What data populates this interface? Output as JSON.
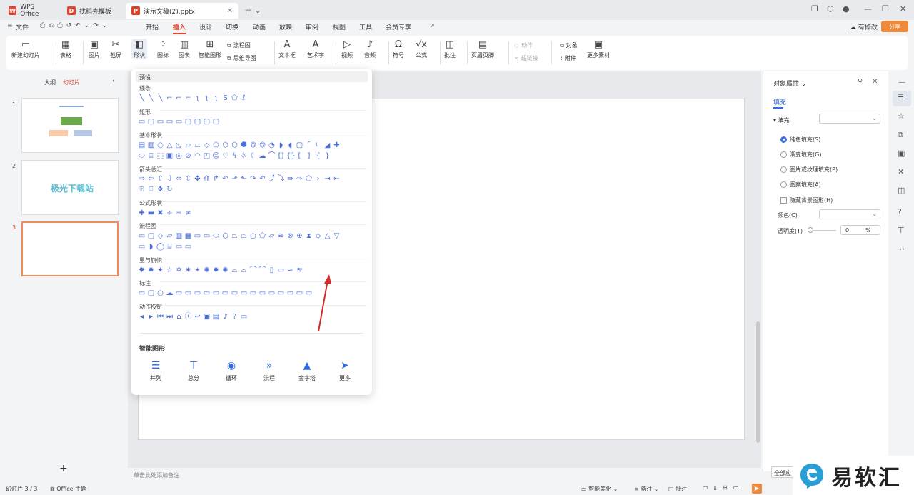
{
  "tabs": [
    {
      "label": "WPS Office",
      "active": false
    },
    {
      "label": "找稻壳模板",
      "active": false
    },
    {
      "label": "演示文稿(2).pptx",
      "active": true
    }
  ],
  "menu": {
    "file": "文件",
    "items": [
      "开始",
      "插入",
      "设计",
      "切换",
      "动画",
      "放映",
      "审阅",
      "视图",
      "工具",
      "会员专享"
    ],
    "active": "插入",
    "edit_status": "有修改",
    "share": "分享"
  },
  "ribbon": {
    "new_slide": "新建幻灯片",
    "table": "表格",
    "picture": "图片",
    "screenshot": "截屏",
    "shape": "形状",
    "icon": "图标",
    "chart": "图表",
    "smart_art": "智能图形",
    "flowchart": "流程图",
    "mindmap": "思维导图",
    "textbox": "文本框",
    "wordart": "艺术字",
    "video": "视频",
    "audio": "音频",
    "symbol": "符号",
    "formula": "公式",
    "comment": "批注",
    "header_footer": "页眉页脚",
    "action": "动作",
    "hyperlink": "超链接",
    "object": "对象",
    "attachment": "附件",
    "more_material": "更多素材"
  },
  "leftpane": {
    "outline": "大纲",
    "slides": "幻灯片",
    "thumbs": [
      "1",
      "2",
      "3"
    ],
    "thumb2_text": "极光下载站"
  },
  "dropdown": {
    "preset": "预设",
    "sections": [
      "线条",
      "矩形",
      "基本形状",
      "箭头总汇",
      "公式形状",
      "流程图",
      "星与旗帜",
      "标注",
      "动作按钮"
    ],
    "smart_title": "智能图形",
    "smart_items": [
      "并列",
      "总分",
      "循环",
      "流程",
      "金字塔",
      "更多"
    ]
  },
  "rightpane": {
    "title": "对象属性",
    "tab": "填充",
    "fill_label": "填充",
    "options": [
      "纯色填充(S)",
      "渐变填充(G)",
      "图片或纹理填充(P)",
      "图案填充(A)"
    ],
    "hide_bg": "隐藏背景图形(H)",
    "color": "颜色(C)",
    "transparency": "透明度(T)",
    "transparency_value": "0",
    "pct": "%",
    "apply_all": "全部应"
  },
  "notes": "单击此处添加备注",
  "status": {
    "slide_count": "幻灯片 3 / 3",
    "theme": "Office 主题",
    "beautify": "智能美化",
    "notes": "备注",
    "comment": "批注"
  },
  "watermark": "易软汇"
}
